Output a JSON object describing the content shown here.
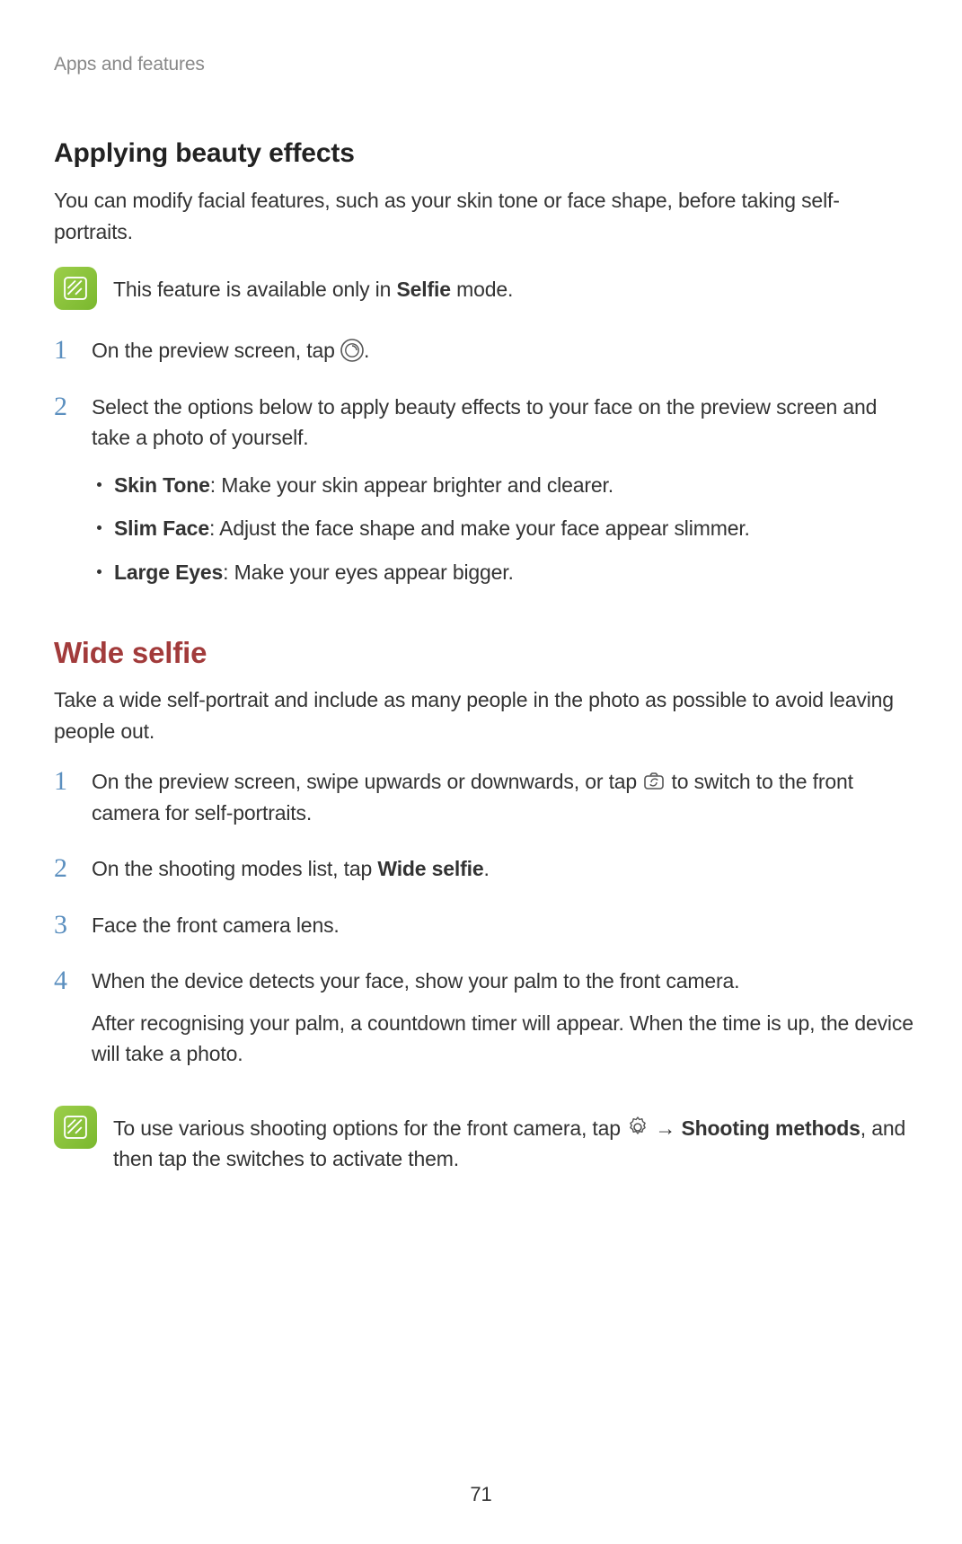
{
  "header": "Apps and features",
  "section1": {
    "title": "Applying beauty effects",
    "intro": "You can modify facial features, such as your skin tone or face shape, before taking self-portraits.",
    "note_pre": "This feature is available only in ",
    "note_bold": "Selfie",
    "note_post": " mode.",
    "step1_pre": "On the preview screen, tap ",
    "step1_post": ".",
    "step2": "Select the options below to apply beauty effects to your face on the preview screen and take a photo of yourself.",
    "bullets": [
      {
        "bold": "Skin Tone",
        "rest": ": Make your skin appear brighter and clearer."
      },
      {
        "bold": "Slim Face",
        "rest": ": Adjust the face shape and make your face appear slimmer."
      },
      {
        "bold": "Large Eyes",
        "rest": ": Make your eyes appear bigger."
      }
    ]
  },
  "section2": {
    "title": "Wide selfie",
    "intro": "Take a wide self-portrait and include as many people in the photo as possible to avoid leaving people out.",
    "step1_pre": "On the preview screen, swipe upwards or downwards, or tap ",
    "step1_post": " to switch to the front camera for self-portraits.",
    "step2_pre": "On the shooting modes list, tap ",
    "step2_bold": "Wide selfie",
    "step2_post": ".",
    "step3": "Face the front camera lens.",
    "step4_a": "When the device detects your face, show your palm to the front camera.",
    "step4_b": "After recognising your palm, a countdown timer will appear. When the time is up, the device will take a photo.",
    "note_pre": "To use various shooting options for the front camera, tap ",
    "note_arrow": " → ",
    "note_bold": "Shooting methods",
    "note_post": ", and then tap the switches to activate them."
  },
  "pageNumber": "71"
}
